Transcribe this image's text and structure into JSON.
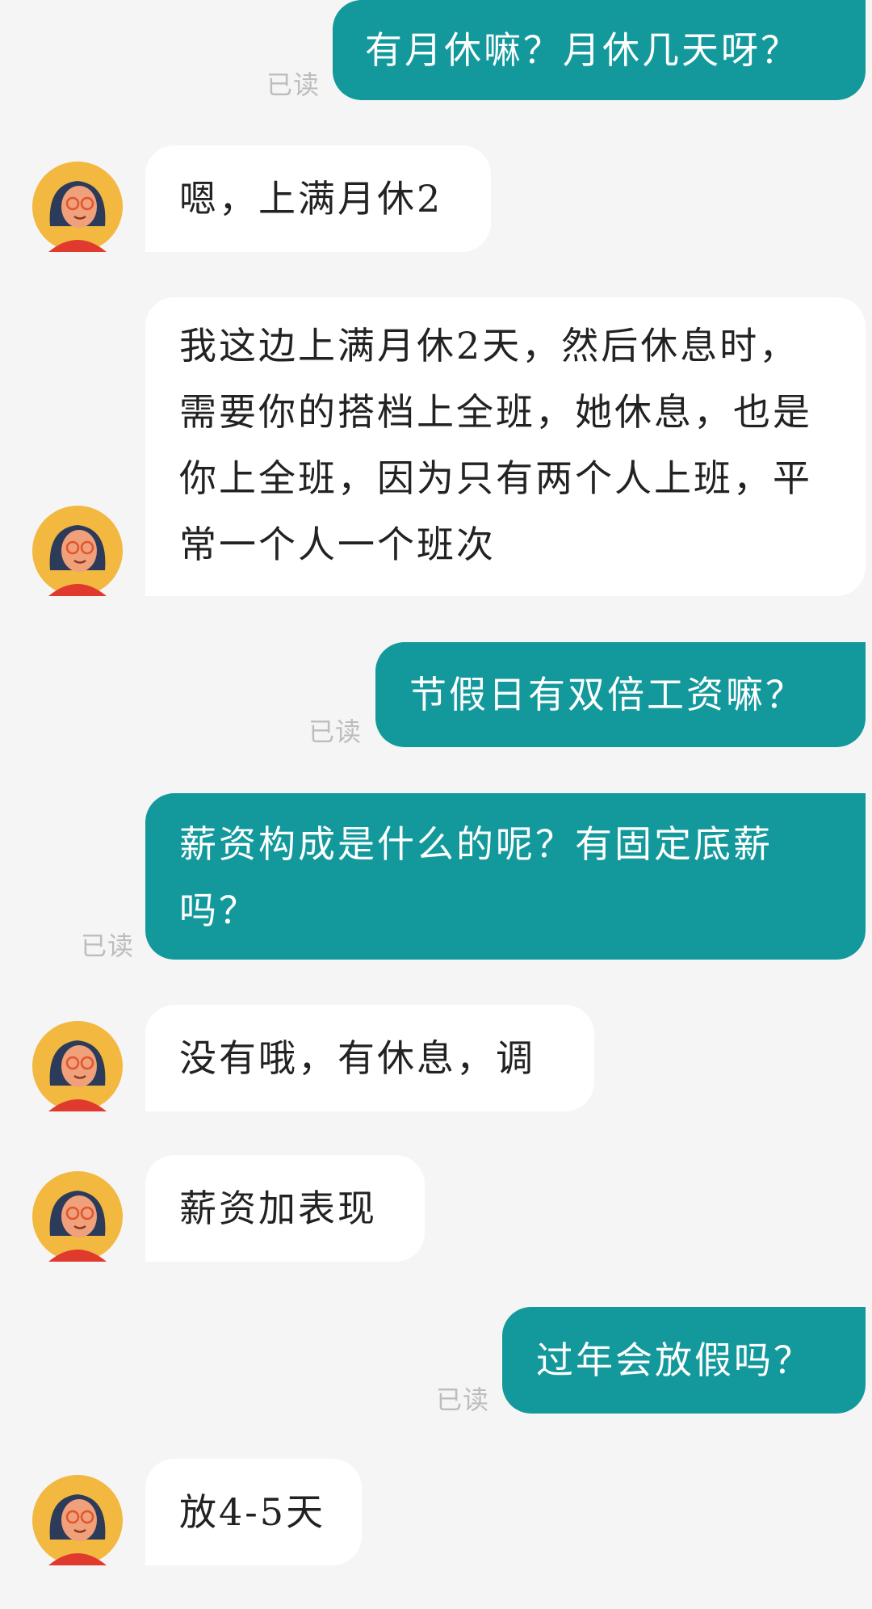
{
  "messages": [
    {
      "dir": "out",
      "text": "有月休嘛？月休几天呀？",
      "read": "已读"
    },
    {
      "dir": "in",
      "text": "嗯，上满月休2"
    },
    {
      "dir": "in",
      "text": "我这边上满月休2天，然后休息时，需要你的搭档上全班，她休息，也是你上全班，因为只有两个人上班，平常一个人一个班次"
    },
    {
      "dir": "out",
      "text": "节假日有双倍工资嘛？",
      "read": "已读"
    },
    {
      "dir": "out",
      "text": "薪资构成是什么的呢？有固定底薪吗？",
      "read": "已读"
    },
    {
      "dir": "in",
      "text": "没有哦，有休息，调"
    },
    {
      "dir": "in",
      "text": "薪资加表现"
    },
    {
      "dir": "out",
      "text": "过年会放假吗？",
      "read": "已读"
    },
    {
      "dir": "in",
      "text": "放4-5天"
    }
  ],
  "colors": {
    "outgoing": "#13999c",
    "incoming": "#ffffff",
    "background": "#f5f5f5"
  },
  "avatar_icon": "woman-with-glasses-avatar"
}
